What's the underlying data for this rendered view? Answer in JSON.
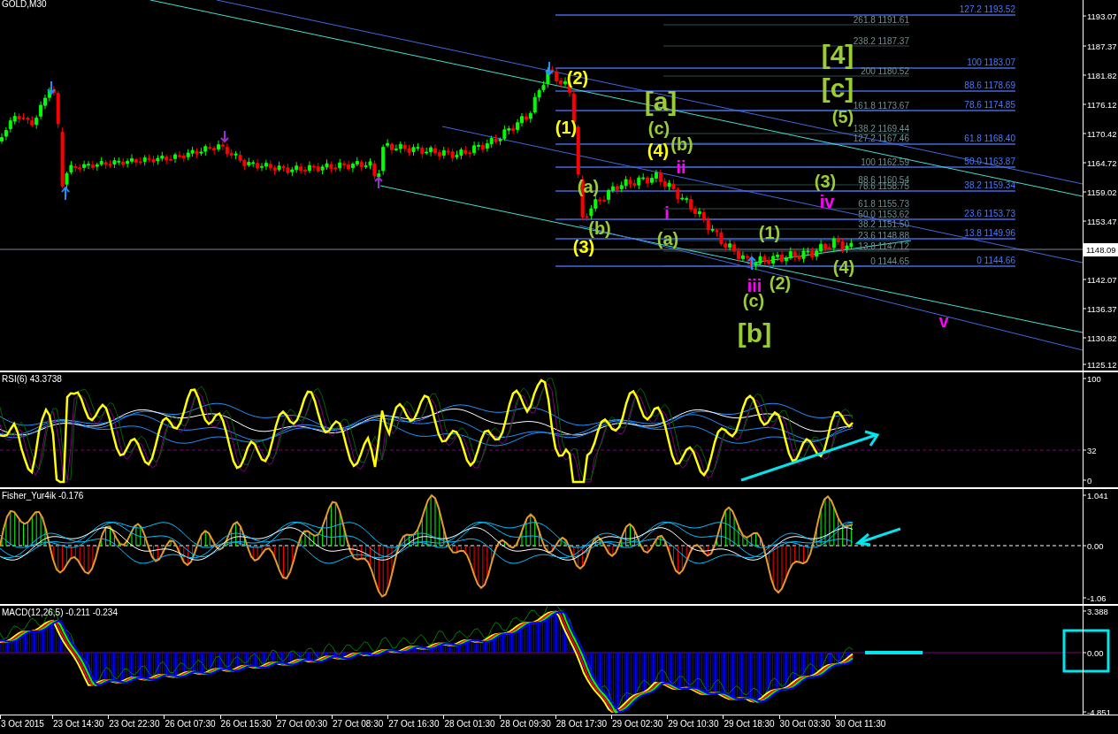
{
  "chart": {
    "symbol": "GOLD,M30"
  },
  "price_axis": [
    "1193.07",
    "1187.37",
    "1181.82",
    "1176.12",
    "1170.42",
    "1164.72",
    "1159.02",
    "1153.47",
    "1142.07",
    "1136.37",
    "1130.82",
    "1125.12"
  ],
  "current_price": "1148.09",
  "fib_right": [
    "127.2 1193.52",
    "100 1183.07",
    "88.6 1178.69",
    "78.6 1174.85",
    "61.8 1168.40",
    "50.0 1163.87",
    "38.2 1159.34",
    "23.6 1153.73",
    "13.8 1149.96",
    "0 1144.66"
  ],
  "fib_left": [
    "261.8 1191.61",
    "238.2 1187.37",
    "200 1180.52",
    "161.8 1173.67",
    "138.2 1169.44",
    "127.2 1167.46",
    "100 1162.59",
    "88.6 1160.54",
    "78.6 1158.75",
    "61.8 1155.73",
    "50.0 1153.62",
    "38.2 1151.50",
    "23.6 1148.88",
    "13.8 1147.12",
    "0 1144.65"
  ],
  "wave_labels": [
    {
      "text": "[4]",
      "color": "#9acd32"
    },
    {
      "text": "(2)",
      "color": "#ffff00"
    },
    {
      "text": "[c]",
      "color": "#9acd32"
    },
    {
      "text": "[a]",
      "color": "#9acd32"
    },
    {
      "text": "(5)",
      "color": "#9acd32"
    },
    {
      "text": "(1)",
      "color": "#ffff00"
    },
    {
      "text": "(c)",
      "color": "#9acd32"
    },
    {
      "text": "(b)",
      "color": "#9acd32"
    },
    {
      "text": "(4)",
      "color": "#ffff00"
    },
    {
      "text": "ii",
      "color": "#ff00ff"
    },
    {
      "text": "(3)",
      "color": "#9acd32"
    },
    {
      "text": "(a)",
      "color": "#9acd32"
    },
    {
      "text": "iv",
      "color": "#ff00ff"
    },
    {
      "text": "i",
      "color": "#ff00ff"
    },
    {
      "text": "(b)",
      "color": "#9acd32"
    },
    {
      "text": "(a)",
      "color": "#9acd32"
    },
    {
      "text": "(1)",
      "color": "#9acd32"
    },
    {
      "text": "(3)",
      "color": "#ffff00"
    },
    {
      "text": "(4)",
      "color": "#9acd32"
    },
    {
      "text": "(2)",
      "color": "#9acd32"
    },
    {
      "text": "iii",
      "color": "#ff00ff"
    },
    {
      "text": "(c)",
      "color": "#9acd32"
    },
    {
      "text": "v",
      "color": "#ff00ff"
    },
    {
      "text": "[b]",
      "color": "#9acd32"
    }
  ],
  "indicators": [
    {
      "title": "RSI(6) 43.3738",
      "axis": [
        "100",
        "32",
        "0"
      ]
    },
    {
      "title": "Fisher_Yur4ik -0.176",
      "axis": [
        "1.041",
        "0.00",
        "-1.06"
      ]
    },
    {
      "title": "MACD(12,26,5) -0.211 -0.234",
      "axis": [
        "3.388",
        "0.00",
        "-4.851"
      ]
    }
  ],
  "time_axis": [
    "3 Oct 2015",
    "23 Oct 14:30",
    "23 Oct 22:30",
    "26 Oct 07:30",
    "26 Oct 15:30",
    "27 Oct 00:30",
    "27 Oct 08:30",
    "27 Oct 16:30",
    "28 Oct 01:30",
    "28 Oct 09:30",
    "28 Oct 17:30",
    "29 Oct 02:30",
    "29 Oct 10:30",
    "29 Oct 18:30",
    "30 Oct 03:30",
    "30 Oct 11:30"
  ]
}
